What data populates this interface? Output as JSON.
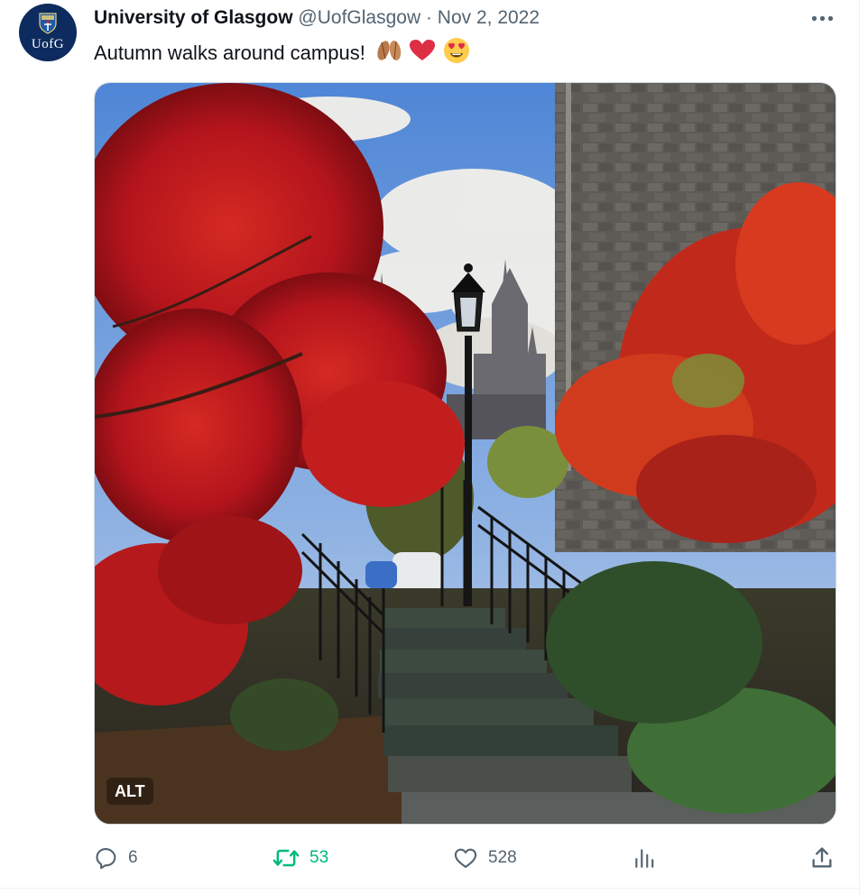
{
  "author": {
    "name": "University of Glasgow",
    "handle": "@UofGlasgow",
    "separator": "·",
    "date": "Nov 2, 2022",
    "avatar_monogram": "UofG",
    "avatar_color": "#0d2b5e"
  },
  "tweet": {
    "text": "Autumn walks around campus!",
    "emojis": [
      "fallen-leaf-emoji",
      "fallen-leaf-emoji",
      "red-heart-emoji",
      "heart-eyes-emoji"
    ]
  },
  "media": {
    "type": "photo",
    "alt_badge": "ALT"
  },
  "actions": {
    "replies": "6",
    "retweets": "53",
    "likes": "528"
  },
  "colors": {
    "muted": "#536471",
    "retweet_green": "#00ba7c",
    "text": "#0f1419"
  }
}
